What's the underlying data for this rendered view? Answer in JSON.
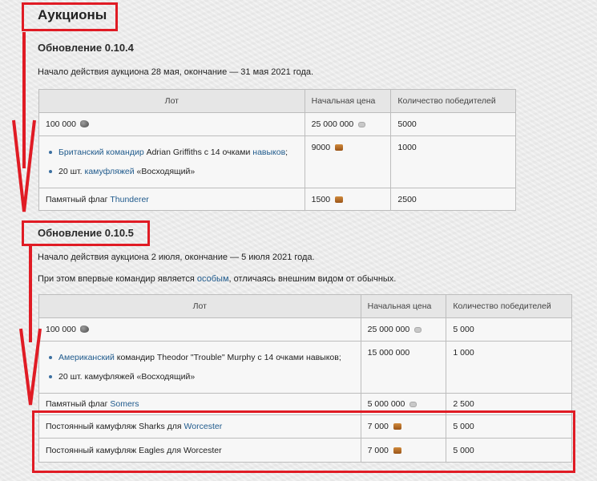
{
  "page": {
    "title": "Аукционы"
  },
  "section1": {
    "heading": "Обновление 0.10.4",
    "intro": "Начало действия аукциона 28 мая, окончание — 31 мая 2021 года.",
    "table": {
      "headers": [
        "Лот",
        "Начальная цена",
        "Количество победителей"
      ],
      "row1": {
        "lot": "100 000",
        "price": "25 000 000",
        "winners": "5000"
      },
      "row2": {
        "item1_link1": "Британский командир",
        "item1_text": "Adrian Griffiths с 14 очками",
        "item1_link2": "навыков",
        "item1_tail": ";",
        "item2_prefix": "20 шт.",
        "item2_link": "камуфляжей",
        "item2_text": "«Восходящий»",
        "price": "9000",
        "winners": "1000"
      },
      "row3": {
        "lot_prefix": "Памятный флаг",
        "lot_link": "Thunderer",
        "price": "1500",
        "winners": "2500"
      }
    }
  },
  "section2": {
    "heading": "Обновление 0.10.5",
    "intro": "Начало действия аукциона 2 июля, окончание — 5 июля 2021 года.",
    "note_prefix": "При этом впервые командир является",
    "note_link": "особым",
    "note_suffix": ", отличаясь внешним видом от обычных.",
    "table": {
      "headers": [
        "Лот",
        "Начальная цена",
        "Количество победителей"
      ],
      "row1": {
        "lot": "100 000",
        "price": "25 000 000",
        "winners": "5 000"
      },
      "row2": {
        "item1_link": "Американский",
        "item1_text": "командир Theodor \"Trouble\" Murphy с 14 очками навыков;",
        "item2_text": "20 шт. камуфляжей «Восходящий»",
        "price": "15 000 000",
        "winners": "1 000"
      },
      "row3": {
        "lot_prefix": "Памятный флаг",
        "lot_link": "Somers",
        "price": "5 000 000",
        "winners": "2 500"
      },
      "row4": {
        "lot_prefix": "Постоянный камуфляж Sharks для",
        "lot_link": "Worcester",
        "price": "7 000",
        "winners": "5 000"
      },
      "row5": {
        "lot": "Постоянный камуфляж Eagles для Worcester",
        "price": "7 000",
        "winners": "5 000"
      }
    }
  },
  "annotation": {
    "color": "#e01b24"
  },
  "icons": {
    "coal": "coal-icon",
    "doubloon": "doubloon-icon",
    "credit": "credit-icon"
  }
}
